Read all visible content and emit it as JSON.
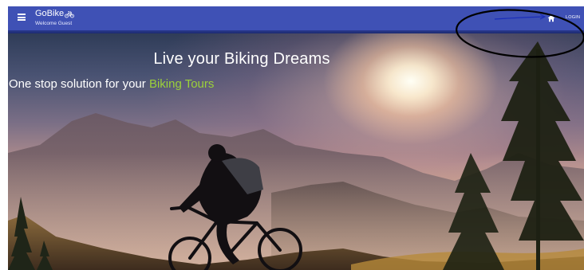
{
  "app": {
    "name": "GoBike",
    "welcome": "Welcome Guest"
  },
  "nav": {
    "login_label": "LOGIN",
    "menu_icon": "hamburger-menu-icon",
    "home_icon": "home-icon",
    "brand_icon": "bicycle-icon"
  },
  "hero": {
    "title": "Live your Biking Dreams",
    "subtitle_prefix": "One stop solution for your ",
    "subtitle_highlight": "Biking Tours"
  },
  "colors": {
    "appbar": "#3f51b5",
    "highlight": "#9cd13a"
  }
}
